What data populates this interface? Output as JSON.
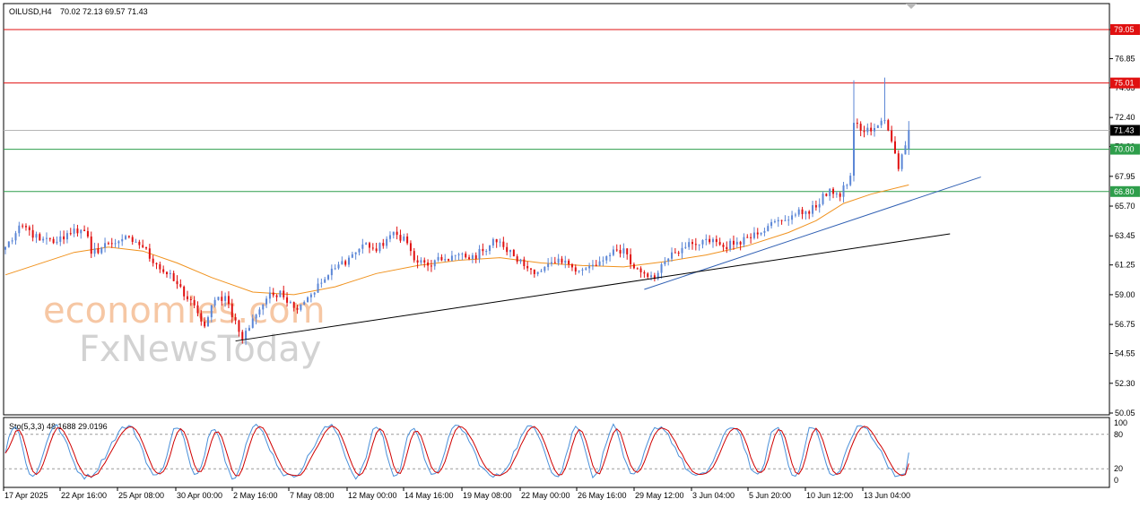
{
  "header": {
    "symbol": "OILUSD,H4",
    "ohlc": "70.02 72.13 69.57 71.43"
  },
  "stoch_header": "Sto(5,3,3) 48.1688 29.0196",
  "watermark": {
    "line1": "economies.com",
    "line2": "FxNewsToday"
  },
  "colors": {
    "bull_candle": "#5b86d6",
    "bear_candle": "#e01010",
    "resistance": "#e01010",
    "support": "#2e9e4b",
    "current_price": "#000000",
    "ma": "#f0921e",
    "blue_trend": "#2f5fb3",
    "black_trend": "#000000",
    "stoch_main": "#4a90d9",
    "stoch_signal": "#d00000"
  },
  "chart_data": {
    "type": "candlestick",
    "symbol": "OILUSD",
    "timeframe": "H4",
    "ohlc_last": {
      "open": 70.02,
      "high": 72.13,
      "low": 69.57,
      "close": 71.43
    },
    "ylim": [
      50.05,
      80.5
    ],
    "y_ticks": [
      79.05,
      76.85,
      74.65,
      72.4,
      70.2,
      67.95,
      65.7,
      63.45,
      61.25,
      59.0,
      56.75,
      54.55,
      52.3,
      50.05
    ],
    "x_ticks": [
      "17 Apr 2025",
      "22 Apr 16:00",
      "25 Apr 08:00",
      "30 Apr 00:00",
      "2 May 16:00",
      "7 May 08:00",
      "12 May 00:00",
      "14 May 16:00",
      "19 May 08:00",
      "22 May 00:00",
      "26 May 16:00",
      "29 May 12:00",
      "3 Jun 04:00",
      "5 Jun 20:00",
      "10 Jun 12:00",
      "13 Jun 04:00"
    ],
    "horizontal_levels": [
      {
        "price": 79.05,
        "label": "79.05",
        "kind": "resistance"
      },
      {
        "price": 75.01,
        "label": "75.01",
        "kind": "resistance"
      },
      {
        "price": 71.43,
        "label": "71.43",
        "kind": "current"
      },
      {
        "price": 70.0,
        "label": "70.00",
        "kind": "support"
      },
      {
        "price": 66.8,
        "label": "66.80",
        "kind": "support"
      }
    ],
    "close_path": [
      [
        0,
        62.6
      ],
      [
        5,
        64.2
      ],
      [
        10,
        63.1
      ],
      [
        15,
        63.0
      ],
      [
        20,
        64.0
      ],
      [
        24,
        63.4
      ],
      [
        25,
        62.1
      ],
      [
        30,
        62.9
      ],
      [
        34,
        63.2
      ],
      [
        38,
        63.0
      ],
      [
        40,
        62.6
      ],
      [
        44,
        61.3
      ],
      [
        50,
        59.8
      ],
      [
        56,
        57.6
      ],
      [
        58,
        56.6
      ],
      [
        61,
        58.6
      ],
      [
        64,
        58.9
      ],
      [
        69,
        55.6
      ],
      [
        72,
        57.2
      ],
      [
        76,
        58.7
      ],
      [
        80,
        59.3
      ],
      [
        84,
        58.0
      ],
      [
        88,
        58.8
      ],
      [
        92,
        59.9
      ],
      [
        96,
        61.0
      ],
      [
        100,
        61.8
      ],
      [
        105,
        62.9
      ],
      [
        108,
        62.3
      ],
      [
        112,
        63.5
      ],
      [
        116,
        63.4
      ],
      [
        119,
        61.6
      ],
      [
        123,
        61.2
      ],
      [
        127,
        61.6
      ],
      [
        131,
        62.0
      ],
      [
        135,
        61.7
      ],
      [
        139,
        62.3
      ],
      [
        142,
        63.2
      ],
      [
        145,
        62.6
      ],
      [
        148,
        61.9
      ],
      [
        152,
        61.0
      ],
      [
        156,
        60.8
      ],
      [
        160,
        61.4
      ],
      [
        164,
        61.3
      ],
      [
        168,
        60.9
      ],
      [
        172,
        61.2
      ],
      [
        176,
        62.0
      ],
      [
        180,
        62.5
      ],
      [
        183,
        61.0
      ],
      [
        186,
        60.6
      ],
      [
        189,
        60.2
      ],
      [
        191,
        61.3
      ],
      [
        194,
        62.2
      ],
      [
        198,
        62.6
      ],
      [
        202,
        62.8
      ],
      [
        206,
        63.2
      ],
      [
        209,
        62.6
      ],
      [
        213,
        63.0
      ],
      [
        218,
        63.7
      ],
      [
        222,
        64.2
      ],
      [
        226,
        64.6
      ],
      [
        229,
        65.0
      ],
      [
        233,
        65.3
      ],
      [
        236,
        65.6
      ],
      [
        240,
        67.0
      ],
      [
        243,
        66.4
      ],
      [
        246,
        68.0
      ],
      [
        247,
        72.0
      ],
      [
        250,
        71.3
      ],
      [
        253,
        71.6
      ],
      [
        256,
        72.2
      ],
      [
        258,
        70.6
      ],
      [
        260,
        68.5
      ],
      [
        263,
        71.43
      ]
    ],
    "moving_average": [
      [
        0,
        60.5
      ],
      [
        20,
        62.2
      ],
      [
        30,
        62.6
      ],
      [
        40,
        62.3
      ],
      [
        50,
        61.4
      ],
      [
        60,
        60.3
      ],
      [
        72,
        59.2
      ],
      [
        84,
        59.0
      ],
      [
        96,
        59.6
      ],
      [
        108,
        60.6
      ],
      [
        120,
        61.2
      ],
      [
        132,
        61.6
      ],
      [
        144,
        61.8
      ],
      [
        156,
        61.4
      ],
      [
        168,
        61.2
      ],
      [
        180,
        61.1
      ],
      [
        192,
        61.5
      ],
      [
        204,
        62.0
      ],
      [
        216,
        62.7
      ],
      [
        228,
        63.7
      ],
      [
        236,
        64.6
      ],
      [
        244,
        65.9
      ],
      [
        252,
        66.6
      ],
      [
        263,
        67.3
      ]
    ],
    "trendlines": [
      {
        "name": "blue",
        "from": [
          186,
          59.4
        ],
        "to": [
          284,
          67.9
        ]
      },
      {
        "name": "black",
        "from": [
          67,
          55.5
        ],
        "to": [
          275,
          63.6
        ]
      }
    ],
    "stochastic": {
      "params": "5,3,3",
      "main": 48.1688,
      "signal": 29.0196,
      "levels": [
        80,
        20
      ],
      "scale": [
        0,
        100
      ]
    }
  }
}
